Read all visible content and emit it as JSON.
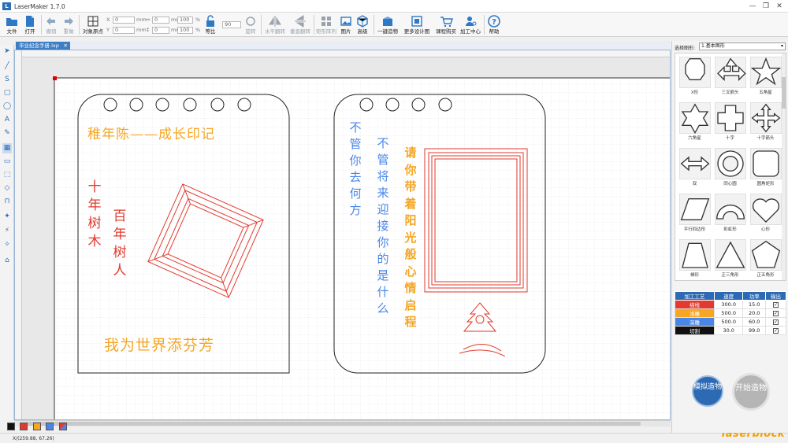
{
  "app": {
    "title": "LaserMaker 1.7.0",
    "logo": "L"
  },
  "window": {
    "minimize": "—",
    "restore": "❐",
    "close": "✕"
  },
  "toolbar": {
    "file": "文件",
    "open": "打开",
    "undo": "撤销",
    "redo": "重做",
    "origin": "对象原点",
    "x_label": "X",
    "x_value": "0",
    "x_unit": "mm",
    "y_label": "Y",
    "y_value": "0",
    "y_unit": "mm",
    "w_value": "0",
    "w_unit": "mm",
    "wp_value": "100",
    "wp_unit": "%",
    "h_value": "0",
    "h_unit": "mm",
    "hp_value": "100",
    "hp_unit": "%",
    "ratio": "等比",
    "angle_value": "90",
    "rotate": "旋转",
    "hflip": "水平翻转",
    "vflip": "垂直翻转",
    "array": "矩形阵列",
    "image": "图片",
    "advanced": "高级",
    "oneclick": "一键造物",
    "more": "更多设计图",
    "shop": "课程购买",
    "center": "加工中心",
    "help": "帮助"
  },
  "tab": {
    "name": "毕业纪念手册.lxp",
    "close": "✕"
  },
  "canvas": {
    "left_page": {
      "title": "稚年陈——成长印记",
      "vert1": [
        "十",
        "年",
        "树",
        "木"
      ],
      "vert2": [
        "百",
        "年",
        "树",
        "人"
      ],
      "bottom": "我为世界添芬芳"
    },
    "right_page": {
      "col1": [
        "不",
        "管",
        "你",
        "去",
        "何",
        "方"
      ],
      "col2": [
        "不",
        "管",
        "将",
        "来",
        "迎",
        "接",
        "你",
        "的",
        "是",
        "什",
        "么"
      ],
      "col3": [
        "请",
        "你",
        "带",
        "着",
        "阳",
        "光",
        "般",
        "心",
        "情",
        "启",
        "程"
      ]
    }
  },
  "palette": [
    "#111111",
    "#e23a2e",
    "#f5a623",
    "#4a86e8",
    "#6a9955"
  ],
  "status": {
    "coords": "X/(259.88, 67.26)",
    "brand": "laserblock"
  },
  "gallery": {
    "label": "选择图形:",
    "selected": "1.基本图形",
    "shapes": [
      "X形",
      "三叉箭头",
      "五角星",
      "六角星",
      "十字",
      "十字箭头",
      "双",
      "同心圆",
      "圆角矩形",
      "平行四边形",
      "彩虹形",
      "心形",
      "梯形",
      "正三角形",
      "正五角形"
    ]
  },
  "process": {
    "headers": [
      "加工工艺",
      "速度",
      "功率",
      "输出"
    ],
    "rows": [
      {
        "name": "描线",
        "color": "#e23a2e",
        "speed": "300.0",
        "power": "15.0",
        "out": "✓"
      },
      {
        "name": "浅雕",
        "color": "#f5a623",
        "speed": "500.0",
        "power": "20.0",
        "out": "✓"
      },
      {
        "name": "深雕",
        "color": "#4a86e8",
        "speed": "500.0",
        "power": "60.0",
        "out": "✓"
      },
      {
        "name": "切割",
        "color": "#111111",
        "speed": "30.0",
        "power": "99.0",
        "out": "✓"
      }
    ]
  },
  "buttons": {
    "simulate": "模拟造物",
    "start": "开始造物"
  }
}
